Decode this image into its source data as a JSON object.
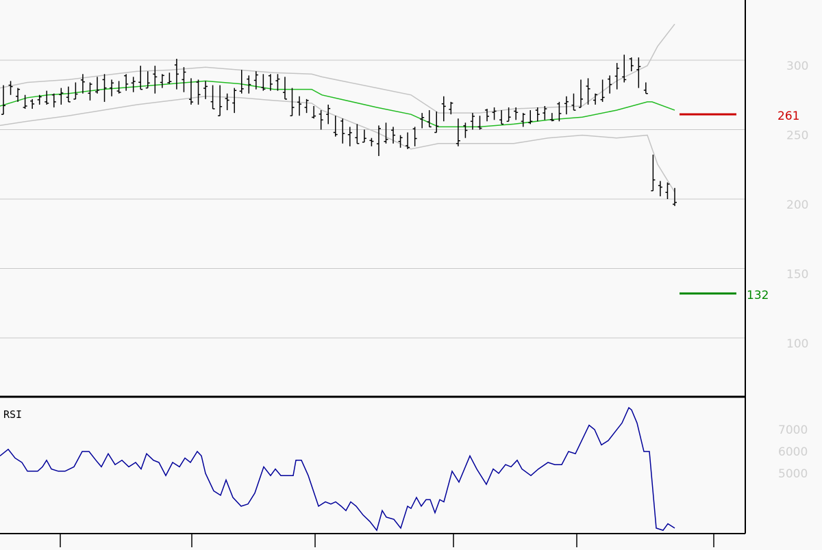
{
  "chart_data": {
    "type": "line",
    "price_panel": {
      "ylim": [
        70,
        320
      ],
      "ticks": [
        {
          "value": 300,
          "label": "300"
        },
        {
          "value": 250,
          "label": "250"
        },
        {
          "value": 200,
          "label": "200"
        },
        {
          "value": 150,
          "label": "150"
        },
        {
          "value": 100,
          "label": "100"
        }
      ],
      "grid": true,
      "bars": [
        [
          282,
          261
        ],
        [
          285,
          275
        ],
        [
          280,
          270
        ],
        [
          275,
          265
        ],
        [
          272,
          265
        ],
        [
          275,
          268
        ],
        [
          278,
          268
        ],
        [
          276,
          266
        ],
        [
          280,
          268
        ],
        [
          281,
          270
        ],
        [
          284,
          272
        ],
        [
          290,
          276
        ],
        [
          284,
          271
        ],
        [
          288,
          276
        ],
        [
          290,
          270
        ],
        [
          286,
          274
        ],
        [
          285,
          276
        ],
        [
          290,
          278
        ],
        [
          288,
          277
        ],
        [
          296,
          279
        ],
        [
          292,
          280
        ],
        [
          296,
          276
        ],
        [
          290,
          280
        ],
        [
          291,
          283
        ],
        [
          301,
          279
        ],
        [
          295,
          277
        ],
        [
          287,
          268
        ],
        [
          286,
          268
        ],
        [
          285,
          272
        ],
        [
          282,
          265
        ],
        [
          282,
          260
        ],
        [
          276,
          264
        ],
        [
          280,
          262
        ],
        [
          293,
          276
        ],
        [
          289,
          276
        ],
        [
          292,
          279
        ],
        [
          290,
          278
        ],
        [
          290,
          278
        ],
        [
          290,
          278
        ],
        [
          288,
          272
        ],
        [
          280,
          260
        ],
        [
          274,
          260
        ],
        [
          272,
          262
        ],
        [
          267,
          258
        ],
        [
          264,
          250
        ],
        [
          268,
          254
        ],
        [
          260,
          245
        ],
        [
          258,
          240
        ],
        [
          252,
          238
        ],
        [
          254,
          240
        ],
        [
          250,
          241
        ],
        [
          244,
          238
        ],
        [
          253,
          231
        ],
        [
          255,
          240
        ],
        [
          252,
          240
        ],
        [
          246,
          237
        ],
        [
          248,
          236
        ],
        [
          252,
          238
        ],
        [
          262,
          251
        ],
        [
          264,
          252
        ],
        [
          263,
          248
        ],
        [
          274,
          256
        ],
        [
          270,
          261
        ],
        [
          258,
          238
        ],
        [
          255,
          244
        ],
        [
          262,
          250
        ],
        [
          260,
          250
        ],
        [
          265,
          256
        ],
        [
          266,
          257
        ],
        [
          264,
          254
        ],
        [
          266,
          256
        ],
        [
          266,
          257
        ],
        [
          262,
          252
        ],
        [
          264,
          254
        ],
        [
          266,
          256
        ],
        [
          267,
          257
        ],
        [
          262,
          256
        ],
        [
          270,
          256
        ],
        [
          274,
          261
        ],
        [
          276,
          264
        ],
        [
          286,
          266
        ],
        [
          287,
          268
        ],
        [
          276,
          268
        ],
        [
          286,
          270
        ],
        [
          289,
          276
        ],
        [
          298,
          279
        ],
        [
          304,
          284
        ],
        [
          302,
          292
        ],
        [
          302,
          280
        ],
        [
          284,
          276
        ],
        [
          232,
          206
        ],
        [
          213,
          202
        ],
        [
          212,
          200
        ],
        [
          208,
          195
        ]
      ],
      "middle_band": [
        [
          0,
          267
        ],
        [
          40,
          273
        ],
        [
          70,
          275
        ],
        [
          100,
          276
        ],
        [
          150,
          279
        ],
        [
          200,
          281
        ],
        [
          250,
          283
        ],
        [
          300,
          285
        ],
        [
          350,
          283
        ],
        [
          400,
          279
        ],
        [
          455,
          279
        ],
        [
          470,
          275
        ],
        [
          550,
          266
        ],
        [
          600,
          261
        ],
        [
          640,
          252
        ],
        [
          700,
          252
        ],
        [
          750,
          254
        ],
        [
          800,
          257
        ],
        [
          850,
          259
        ],
        [
          900,
          264
        ],
        [
          945,
          270
        ],
        [
          952,
          270
        ],
        [
          985,
          264
        ]
      ],
      "upper_band": [
        [
          0,
          280
        ],
        [
          40,
          284
        ],
        [
          70,
          285
        ],
        [
          100,
          286
        ],
        [
          150,
          289
        ],
        [
          200,
          292
        ],
        [
          250,
          293
        ],
        [
          300,
          295
        ],
        [
          350,
          293
        ],
        [
          400,
          291
        ],
        [
          455,
          290
        ],
        [
          470,
          288
        ],
        [
          550,
          280
        ],
        [
          600,
          275
        ],
        [
          640,
          262
        ],
        [
          700,
          262
        ],
        [
          750,
          265
        ],
        [
          800,
          266
        ],
        [
          850,
          267
        ],
        [
          900,
          285
        ],
        [
          945,
          296
        ],
        [
          960,
          310
        ],
        [
          985,
          326
        ]
      ],
      "lower_band": [
        [
          0,
          253
        ],
        [
          40,
          256
        ],
        [
          70,
          258
        ],
        [
          100,
          260
        ],
        [
          150,
          264
        ],
        [
          200,
          268
        ],
        [
          250,
          271
        ],
        [
          300,
          274
        ],
        [
          350,
          273
        ],
        [
          400,
          271
        ],
        [
          455,
          269
        ],
        [
          470,
          264
        ],
        [
          550,
          248
        ],
        [
          600,
          236
        ],
        [
          640,
          240
        ],
        [
          700,
          240
        ],
        [
          750,
          240
        ],
        [
          800,
          244
        ],
        [
          850,
          246
        ],
        [
          900,
          244
        ],
        [
          945,
          246
        ],
        [
          960,
          225
        ],
        [
          985,
          205
        ]
      ],
      "levels": [
        {
          "value": 261,
          "label": "261",
          "color": "#cc0000"
        },
        {
          "value": 132,
          "label": "132",
          "color": "#008800"
        }
      ]
    },
    "rsi_panel": {
      "title": "RSI",
      "ticks": [
        {
          "value": 70,
          "label": "7000"
        },
        {
          "value": 60,
          "label": "6000"
        },
        {
          "value": 50,
          "label": "5000"
        }
      ],
      "ylim": [
        20,
        82
      ],
      "values": [
        [
          0,
          58
        ],
        [
          12,
          61
        ],
        [
          22,
          57
        ],
        [
          32,
          55
        ],
        [
          40,
          51
        ],
        [
          55,
          51
        ],
        [
          62,
          53
        ],
        [
          68,
          56
        ],
        [
          75,
          52
        ],
        [
          85,
          51
        ],
        [
          95,
          51
        ],
        [
          108,
          53
        ],
        [
          120,
          60
        ],
        [
          130,
          60
        ],
        [
          140,
          56
        ],
        [
          148,
          53
        ],
        [
          158,
          59
        ],
        [
          168,
          54
        ],
        [
          178,
          56
        ],
        [
          188,
          53
        ],
        [
          198,
          55
        ],
        [
          206,
          52
        ],
        [
          214,
          59
        ],
        [
          224,
          56
        ],
        [
          232,
          55
        ],
        [
          242,
          49
        ],
        [
          252,
          55
        ],
        [
          262,
          53
        ],
        [
          270,
          57
        ],
        [
          278,
          55
        ],
        [
          288,
          60
        ],
        [
          294,
          58
        ],
        [
          300,
          50
        ],
        [
          312,
          42
        ],
        [
          322,
          40
        ],
        [
          330,
          47
        ],
        [
          340,
          39
        ],
        [
          352,
          35
        ],
        [
          362,
          36
        ],
        [
          372,
          41
        ],
        [
          385,
          53
        ],
        [
          395,
          49
        ],
        [
          402,
          52
        ],
        [
          410,
          49
        ],
        [
          420,
          49
        ],
        [
          428,
          49
        ],
        [
          432,
          56
        ],
        [
          440,
          56
        ],
        [
          450,
          49
        ],
        [
          465,
          35
        ],
        [
          475,
          37
        ],
        [
          483,
          36
        ],
        [
          490,
          37
        ],
        [
          498,
          35
        ],
        [
          505,
          33
        ],
        [
          512,
          37
        ],
        [
          520,
          35
        ],
        [
          530,
          31
        ],
        [
          540,
          28
        ],
        [
          550,
          24
        ],
        [
          558,
          33
        ],
        [
          564,
          30
        ],
        [
          575,
          29
        ],
        [
          585,
          25
        ],
        [
          595,
          35
        ],
        [
          600,
          34
        ],
        [
          608,
          39
        ],
        [
          615,
          35
        ],
        [
          622,
          38
        ],
        [
          628,
          38
        ],
        [
          635,
          32
        ],
        [
          642,
          38
        ],
        [
          648,
          37
        ],
        [
          660,
          51
        ],
        [
          670,
          46
        ],
        [
          686,
          58
        ],
        [
          696,
          52
        ],
        [
          710,
          45
        ],
        [
          720,
          52
        ],
        [
          728,
          50
        ],
        [
          738,
          54
        ],
        [
          746,
          53
        ],
        [
          755,
          56
        ],
        [
          762,
          52
        ],
        [
          775,
          49
        ],
        [
          786,
          52
        ],
        [
          800,
          55
        ],
        [
          810,
          54
        ],
        [
          820,
          54
        ],
        [
          830,
          60
        ],
        [
          840,
          59
        ],
        [
          860,
          72
        ],
        [
          868,
          70
        ],
        [
          878,
          63
        ],
        [
          888,
          65
        ],
        [
          898,
          69
        ],
        [
          908,
          73
        ],
        [
          918,
          80
        ],
        [
          922,
          79
        ],
        [
          930,
          73
        ],
        [
          940,
          60
        ],
        [
          948,
          60
        ],
        [
          958,
          25
        ],
        [
          968,
          24
        ],
        [
          975,
          27
        ],
        [
          985,
          25
        ]
      ]
    }
  }
}
